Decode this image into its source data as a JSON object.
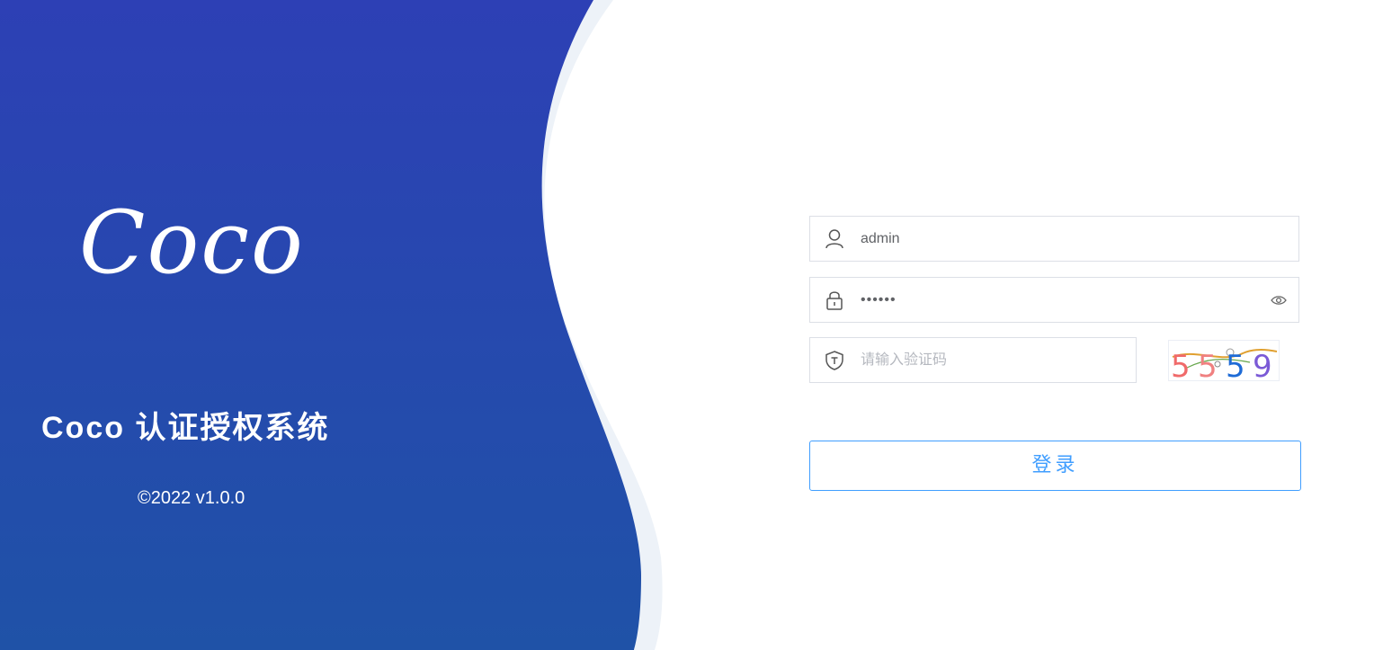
{
  "brand": {
    "logo_text": "Coco",
    "system_title": "Coco 认证授权系统",
    "copyright": "©2022 v1.0.0"
  },
  "form": {
    "username": {
      "value": "admin",
      "icon": "user-icon"
    },
    "password": {
      "value": "123456",
      "icon": "lock-icon",
      "toggle_icon": "eye-icon"
    },
    "captcha": {
      "placeholder": "请输入验证码",
      "icon": "shield-icon",
      "image_text": "5559"
    },
    "login_label": "登录"
  },
  "colors": {
    "panel_top": "#2d44b5",
    "panel_bottom": "#1f52a7",
    "accent": "#409eff",
    "input_border": "#dcdfe6"
  }
}
